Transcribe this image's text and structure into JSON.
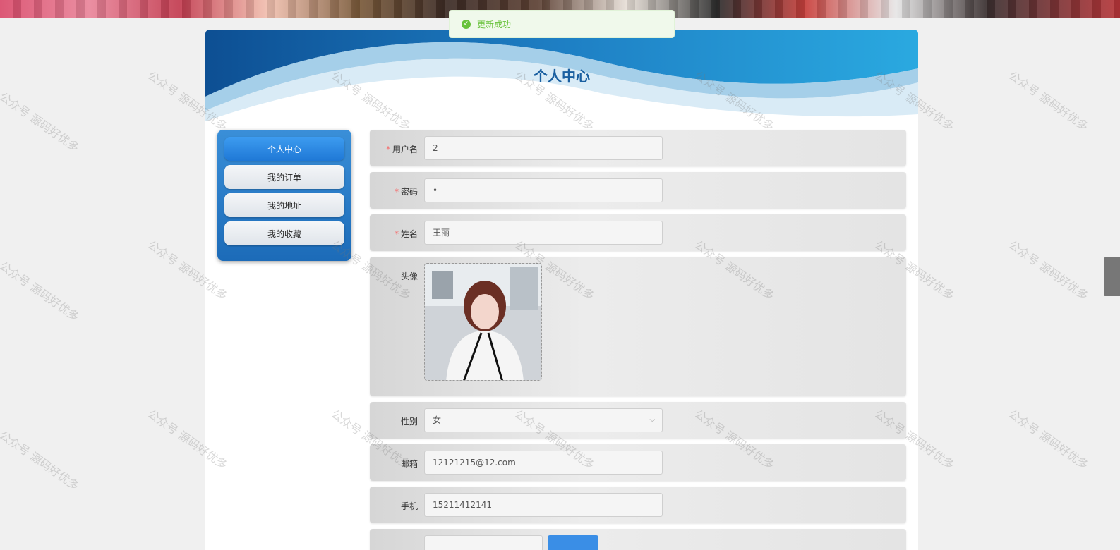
{
  "toast": {
    "message": "更新成功"
  },
  "page_title": "个人中心",
  "sidebar": {
    "items": [
      {
        "label": "个人中心",
        "active": true
      },
      {
        "label": "我的订单",
        "active": false
      },
      {
        "label": "我的地址",
        "active": false
      },
      {
        "label": "我的收藏",
        "active": false
      }
    ]
  },
  "form": {
    "username": {
      "label": "用户名",
      "required": "*",
      "value": "2"
    },
    "password": {
      "label": "密码",
      "required": "*",
      "value": "•"
    },
    "name": {
      "label": "姓名",
      "required": "*",
      "value": "王丽"
    },
    "avatar": {
      "label": "头像"
    },
    "gender": {
      "label": "性别",
      "value": "女"
    },
    "email": {
      "label": "邮箱",
      "value": "12121215@12.com"
    },
    "phone": {
      "label": "手机",
      "value": "15211412141"
    }
  },
  "watermark": "公众号 源码好优多",
  "colors": {
    "accent": "#1f78d6",
    "success": "#67c23a",
    "title": "#1a5fa0"
  }
}
